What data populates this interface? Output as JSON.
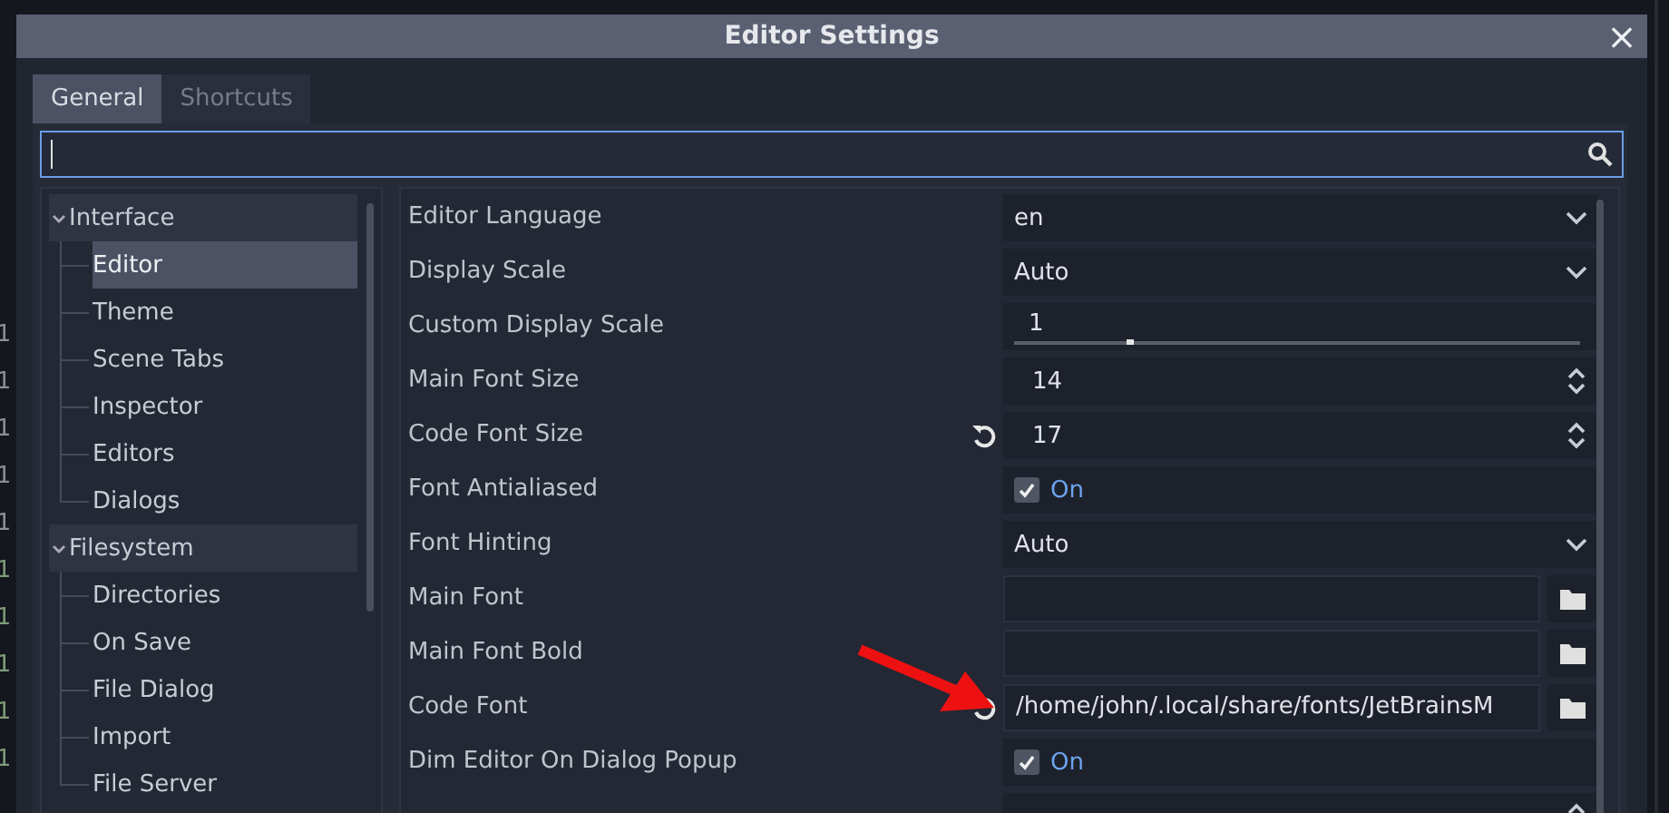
{
  "background_editor": {
    "line_numbers": [
      {
        "text": "1",
        "color": "#8a8f99"
      },
      {
        "text": "1",
        "color": "#8a8f99"
      },
      {
        "text": "1",
        "color": "#8a8f99"
      },
      {
        "text": "1",
        "color": "#8a8f99"
      },
      {
        "text": "1",
        "color": "#8a8f99"
      },
      {
        "text": "1",
        "color": "#7d9c79"
      },
      {
        "text": "1",
        "color": "#7d9c79"
      },
      {
        "text": "1",
        "color": "#7d9c79"
      },
      {
        "text": "1",
        "color": "#7d9c79"
      },
      {
        "text": "1",
        "color": "#7d9c79"
      }
    ]
  },
  "window": {
    "title": "Editor Settings",
    "close": "×"
  },
  "tabs": [
    {
      "label": "General",
      "selected": true
    },
    {
      "label": "Shortcuts",
      "selected": false
    }
  ],
  "search": {
    "focused": true
  },
  "sidebar": {
    "items": [
      {
        "label": "Interface",
        "selected": false,
        "expanded": true,
        "children": [
          {
            "label": "Editor",
            "selected": true
          },
          {
            "label": "Theme",
            "selected": false
          },
          {
            "label": "Scene Tabs",
            "selected": false
          },
          {
            "label": "Inspector",
            "selected": false
          },
          {
            "label": "Editors",
            "selected": false
          },
          {
            "label": "Dialogs",
            "selected": false
          }
        ]
      },
      {
        "label": "Filesystem",
        "selected": false,
        "expanded": true,
        "children": [
          {
            "label": "Directories",
            "selected": false
          },
          {
            "label": "On Save",
            "selected": false
          },
          {
            "label": "File Dialog",
            "selected": false
          },
          {
            "label": "Import",
            "selected": false
          },
          {
            "label": "File Server",
            "selected": false
          }
        ]
      }
    ]
  },
  "properties": [
    {
      "label": "Editor Language",
      "kind": "dropdown",
      "value": "en",
      "revertable": false
    },
    {
      "label": "Display Scale",
      "kind": "dropdown",
      "value": "Auto",
      "revertable": false
    },
    {
      "label": "Custom Display Scale",
      "kind": "slider",
      "value": "1",
      "level": 0.2,
      "revertable": false
    },
    {
      "label": "Main Font Size",
      "kind": "spin",
      "value": "14",
      "revertable": false
    },
    {
      "label": "Code Font Size",
      "kind": "spin",
      "value": "17",
      "revertable": true
    },
    {
      "label": "Font Antialiased",
      "kind": "checkbox",
      "value": "On",
      "checked": true,
      "revertable": false
    },
    {
      "label": "Font Hinting",
      "kind": "dropdown",
      "value": "Auto",
      "revertable": false
    },
    {
      "label": "Main Font",
      "kind": "file",
      "revertable": false
    },
    {
      "label": "Main Font Bold",
      "kind": "file",
      "revertable": false
    },
    {
      "label": "Code Font",
      "kind": "file",
      "value": "/home/john/.local/share/fonts/JetBrainsM",
      "revertable": true
    },
    {
      "label": "Dim Editor On Dialog Popup",
      "kind": "checkbox",
      "value": "On",
      "checked": true,
      "revertable": false
    },
    {
      "kind": "spin",
      "revertable": false
    }
  ]
}
